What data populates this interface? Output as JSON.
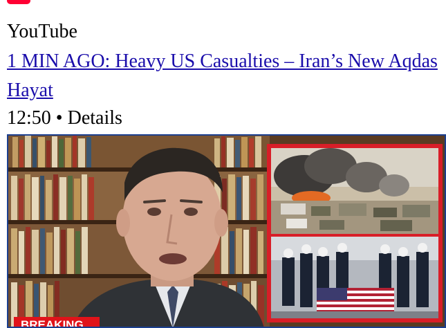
{
  "result": {
    "source_name": "YouTube",
    "title": "1 MIN AGO: Heavy US Casualties – Iran’s New Aqdas Hayat",
    "duration": "12:50",
    "separator": "•",
    "details_label": "Details"
  },
  "thumbnail": {
    "badge_text": "BREAKING",
    "badge_color": "#e0131a",
    "frame_color": "#d81e28",
    "border_color": "#1b3f8f"
  },
  "icons": {
    "source": "youtube-logo-icon"
  }
}
